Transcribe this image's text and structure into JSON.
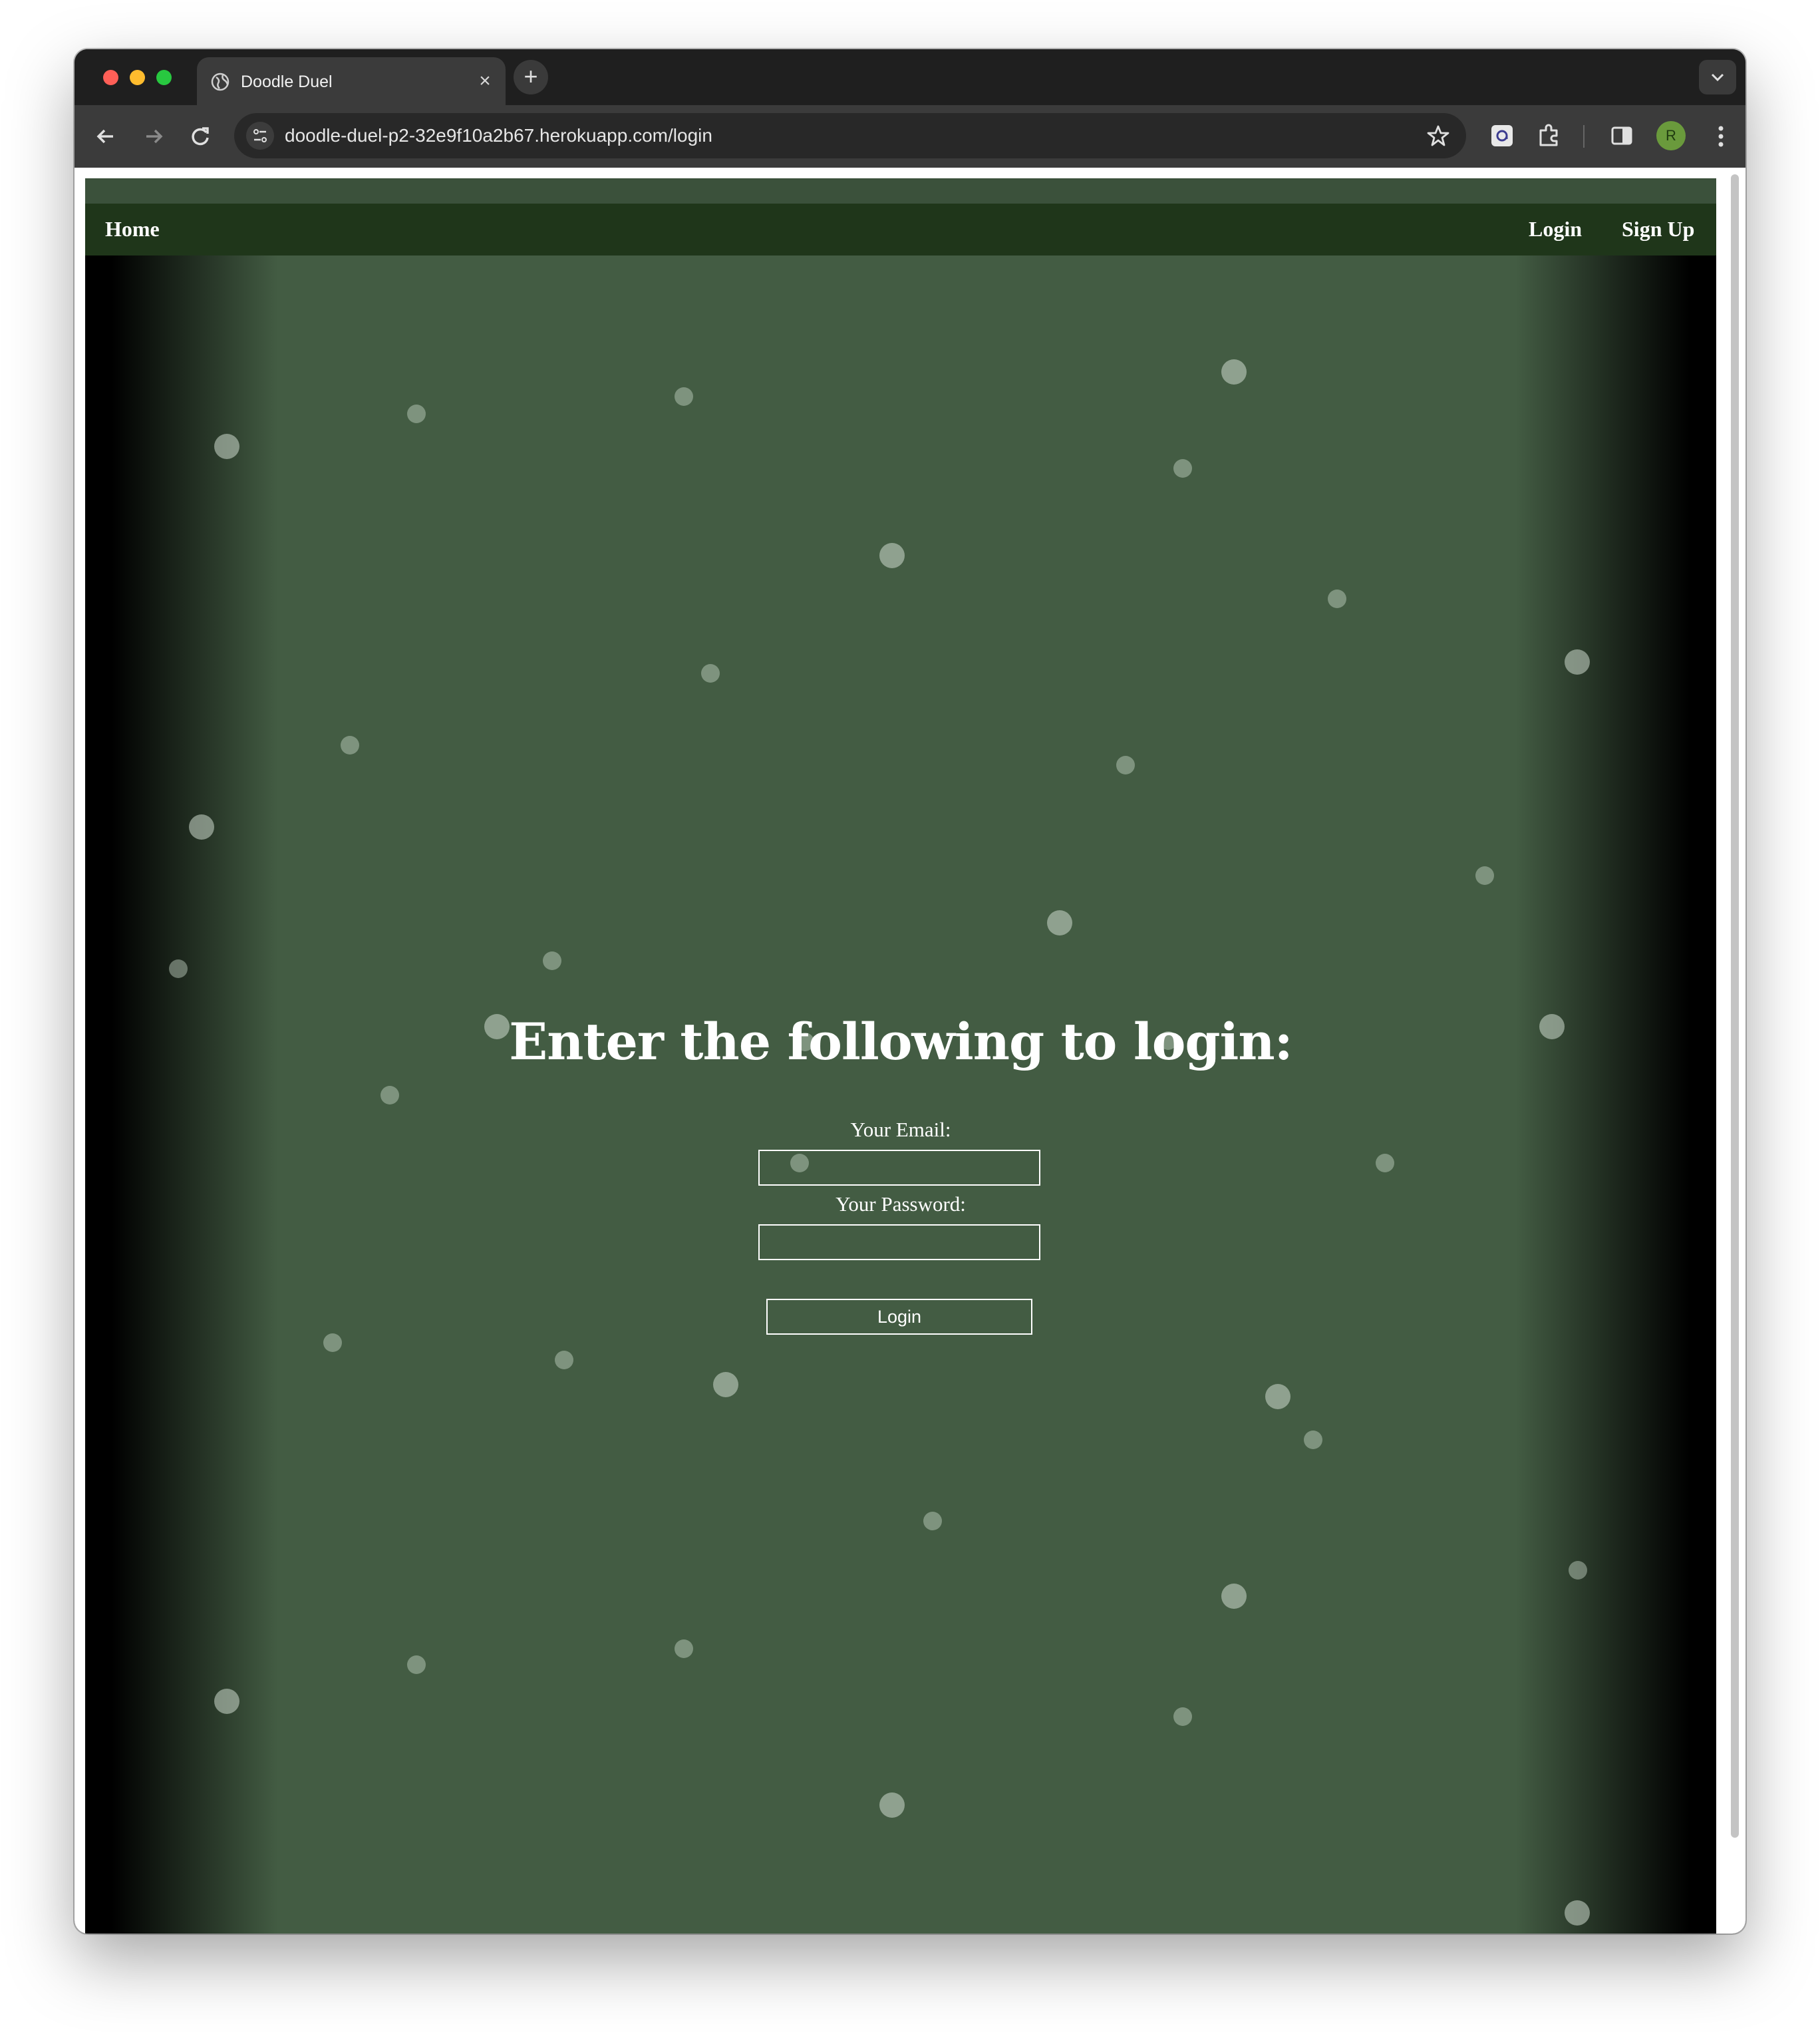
{
  "browser": {
    "tab_title": "Doodle Duel",
    "tab_close": "×",
    "new_tab": "+",
    "url": "doodle-duel-p2-32e9f10a2b67.herokuapp.com/login",
    "profile_initial": "R"
  },
  "site": {
    "nav": {
      "home": "Home",
      "login": "Login",
      "signup": "Sign Up"
    },
    "login_form": {
      "heading": "Enter the following to login:",
      "email_label": "Your Email:",
      "email_value": "",
      "password_label": "Your Password:",
      "password_value": "",
      "submit_label": "Login"
    }
  },
  "colors": {
    "page_background": "#435c43",
    "nav_background": "#1f361a",
    "text": "#ffffff"
  }
}
